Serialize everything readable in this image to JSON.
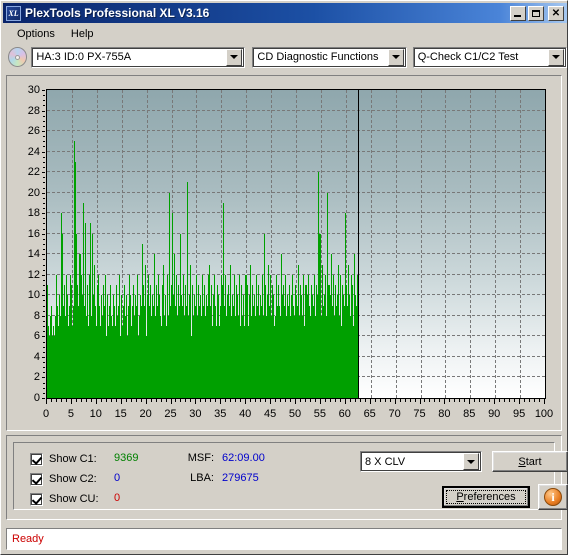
{
  "window": {
    "title": "PlexTools Professional XL V3.16",
    "icon_label": "XL",
    "minimize_label": "_",
    "maximize_label": "□",
    "close_label": "✕"
  },
  "menu": {
    "items": [
      {
        "label": "Options"
      },
      {
        "label": "Help"
      }
    ]
  },
  "toolbar": {
    "drive_combo": {
      "value": "HA:3 ID:0  PX-755A"
    },
    "function_combo": {
      "value": "CD Diagnostic Functions"
    },
    "test_combo": {
      "value": "Q-Check C1/C2 Test"
    }
  },
  "chart_data": {
    "type": "bar",
    "title": "",
    "xlabel": "",
    "ylabel": "",
    "xlim": [
      0,
      100
    ],
    "ylim": [
      0,
      30
    ],
    "grid": true,
    "legend_position": "none",
    "x_ticks": [
      0,
      5,
      10,
      15,
      20,
      25,
      30,
      35,
      40,
      45,
      50,
      55,
      60,
      65,
      70,
      75,
      80,
      85,
      90,
      95,
      100
    ],
    "y_ticks": [
      0,
      2,
      4,
      6,
      8,
      10,
      12,
      14,
      16,
      18,
      20,
      22,
      24,
      26,
      28,
      30
    ],
    "series_color": "#00a000",
    "background_top": "#8fa7ad",
    "background_bottom": "#ffffff",
    "data_end_x": 62.5,
    "series": [
      {
        "name": "C1",
        "color": "#00a000",
        "values": [
          6,
          11,
          4,
          7,
          3,
          6,
          5,
          8,
          4,
          9,
          6,
          5,
          1,
          7,
          4,
          6,
          3,
          8,
          5,
          12,
          6,
          4,
          9,
          3,
          7,
          5,
          10,
          4,
          6,
          8,
          3,
          18,
          7,
          5,
          16,
          4,
          9,
          6,
          11,
          5,
          8,
          3,
          12,
          6,
          4,
          10,
          7,
          5,
          9,
          4,
          12,
          6,
          8,
          5,
          11,
          4,
          7,
          9,
          3,
          6,
          25,
          8,
          23,
          5,
          16,
          7,
          4,
          11,
          6,
          9,
          3,
          8,
          14,
          5,
          7,
          4,
          12,
          6,
          10,
          3,
          19,
          7,
          5,
          9,
          4,
          17,
          6,
          8,
          11,
          5,
          3,
          7,
          9,
          4,
          12,
          6,
          17,
          5,
          8,
          3,
          16,
          7,
          4,
          10,
          6,
          13,
          5,
          9,
          3,
          7,
          11,
          4,
          8,
          6,
          12,
          5,
          9,
          4,
          7,
          3,
          10,
          6,
          8,
          4,
          11,
          7,
          5,
          9,
          3,
          12,
          6,
          4,
          8,
          5,
          10,
          7,
          3,
          6,
          9,
          4,
          11,
          5,
          8,
          3,
          7,
          6,
          10,
          4,
          9,
          5,
          7,
          3,
          11,
          6,
          4,
          8,
          5,
          9,
          3,
          12,
          7,
          4,
          6,
          10,
          5,
          8,
          3,
          7,
          9,
          4,
          11,
          6,
          5,
          8,
          3,
          10,
          7,
          4,
          6,
          9,
          5,
          12,
          3,
          8,
          6,
          10,
          4,
          7,
          9,
          5,
          11,
          3,
          6,
          8,
          4,
          10,
          7,
          5,
          9,
          3,
          12,
          6,
          4,
          8,
          5,
          7,
          10,
          3,
          9,
          6,
          15,
          4,
          8,
          11,
          5,
          9,
          3,
          7,
          13,
          6,
          4,
          10,
          8,
          5,
          12,
          3,
          9,
          7,
          4,
          11,
          6,
          8,
          5,
          10,
          3,
          7,
          9,
          4,
          14,
          6,
          8,
          5,
          11,
          3,
          9,
          7,
          4,
          12,
          6,
          10,
          5,
          8,
          3,
          7,
          11,
          4,
          9,
          6,
          13,
          5,
          8,
          3,
          10,
          7,
          4,
          9,
          6,
          12,
          5,
          8,
          20,
          6,
          9,
          4,
          11,
          7,
          5,
          18,
          8,
          3,
          10,
          6,
          14,
          4,
          9,
          7,
          12,
          5,
          8,
          3,
          11,
          6,
          9,
          4,
          16,
          7,
          5,
          10,
          8,
          3,
          9,
          6,
          12,
          4,
          8,
          7,
          11,
          5,
          9,
          3,
          21,
          6,
          8,
          4,
          10,
          7,
          5,
          13,
          9,
          3,
          6,
          11,
          4,
          8,
          7,
          5,
          10,
          3,
          9,
          6,
          12,
          4,
          8,
          5,
          11,
          7,
          3,
          9,
          6,
          10,
          4,
          8,
          5,
          12,
          3,
          7,
          9,
          6,
          11,
          4,
          8,
          5,
          10,
          3,
          9,
          7,
          4,
          12,
          6,
          8,
          13,
          5,
          9,
          3,
          11,
          7,
          4,
          8,
          6,
          10,
          5,
          12,
          3,
          9,
          7,
          4,
          11,
          6,
          8,
          5,
          10,
          3,
          7,
          9,
          4,
          12,
          6,
          8,
          5,
          11,
          19,
          7,
          4,
          9,
          6,
          12,
          5,
          8,
          3,
          10,
          7,
          4,
          11,
          6,
          9,
          5,
          13,
          3,
          8,
          7,
          4,
          10,
          6,
          9,
          5,
          12,
          3,
          8,
          11,
          4,
          9,
          6,
          10,
          5,
          8,
          3,
          12,
          7,
          4,
          9,
          6,
          11,
          5,
          8,
          3,
          10,
          7,
          4,
          9,
          6,
          12,
          5,
          8,
          3,
          11,
          7,
          4,
          10,
          6,
          9,
          5,
          13,
          3,
          8,
          7,
          11,
          4,
          9,
          6,
          10,
          5,
          8,
          3,
          12,
          7,
          4,
          9,
          6,
          11,
          5,
          8,
          3,
          10,
          7,
          4,
          9,
          6,
          12,
          5,
          8,
          16,
          4,
          9,
          7,
          11,
          5,
          8,
          3,
          10,
          6,
          13,
          4,
          9,
          7,
          5,
          12,
          8,
          3,
          11,
          6,
          9,
          4,
          10,
          7,
          5,
          8,
          3,
          12,
          6,
          9,
          4,
          11,
          7,
          5,
          9,
          3,
          8,
          6,
          14,
          4,
          10,
          7,
          5,
          11,
          8,
          3,
          9,
          6,
          12,
          4,
          8,
          7,
          10,
          5,
          9,
          3,
          11,
          6,
          8,
          4,
          10,
          7,
          5,
          12,
          3,
          9,
          6,
          8,
          4,
          11,
          7,
          5,
          10,
          3,
          9,
          6,
          13,
          4,
          8,
          7,
          11,
          5,
          9,
          3,
          10,
          6,
          8,
          4,
          12,
          7,
          5,
          9,
          3,
          11,
          6,
          8,
          4,
          10,
          7,
          12,
          5,
          9,
          3,
          8,
          6,
          11,
          4,
          10,
          7,
          5,
          9,
          3,
          12,
          6,
          8,
          4,
          11,
          7,
          5,
          10,
          22,
          5,
          9,
          7,
          16,
          4,
          11,
          6,
          8,
          3,
          13,
          9,
          5,
          10,
          7,
          4,
          12,
          6,
          8,
          5,
          20,
          3,
          9,
          7,
          11,
          4,
          8,
          6,
          10,
          5,
          14,
          3,
          9,
          7,
          12,
          4,
          8,
          6,
          11,
          5,
          9,
          3,
          10,
          7,
          4,
          13,
          6,
          8,
          5,
          12,
          9,
          3,
          7,
          11,
          4,
          8,
          6,
          10,
          5,
          9,
          18,
          4,
          8,
          11,
          6,
          9,
          3,
          13,
          7,
          5,
          10,
          4,
          8,
          12,
          6,
          9,
          3,
          11,
          7,
          5,
          14,
          8,
          4,
          10,
          6,
          9,
          5,
          12,
          3,
          8
        ]
      }
    ]
  },
  "panel": {
    "checkboxes": [
      {
        "name": "show-c1",
        "label": "Show C1:",
        "checked": true,
        "value": "9369",
        "value_color": "#008000"
      },
      {
        "name": "show-c2",
        "label": "Show C2:",
        "checked": true,
        "value": "0",
        "value_color": "#0000cc"
      },
      {
        "name": "show-cu",
        "label": "Show CU:",
        "checked": true,
        "value": "0",
        "value_color": "#cc0000"
      }
    ],
    "msf_label": "MSF:",
    "msf_value": "62:09.00",
    "lba_label": "LBA:",
    "lba_value": "279675",
    "speed_combo": {
      "value": "8 X CLV"
    },
    "start_button": "Start",
    "preferences_button": "Preferences",
    "info_button": "i"
  },
  "statusbar": {
    "text": "Ready"
  }
}
